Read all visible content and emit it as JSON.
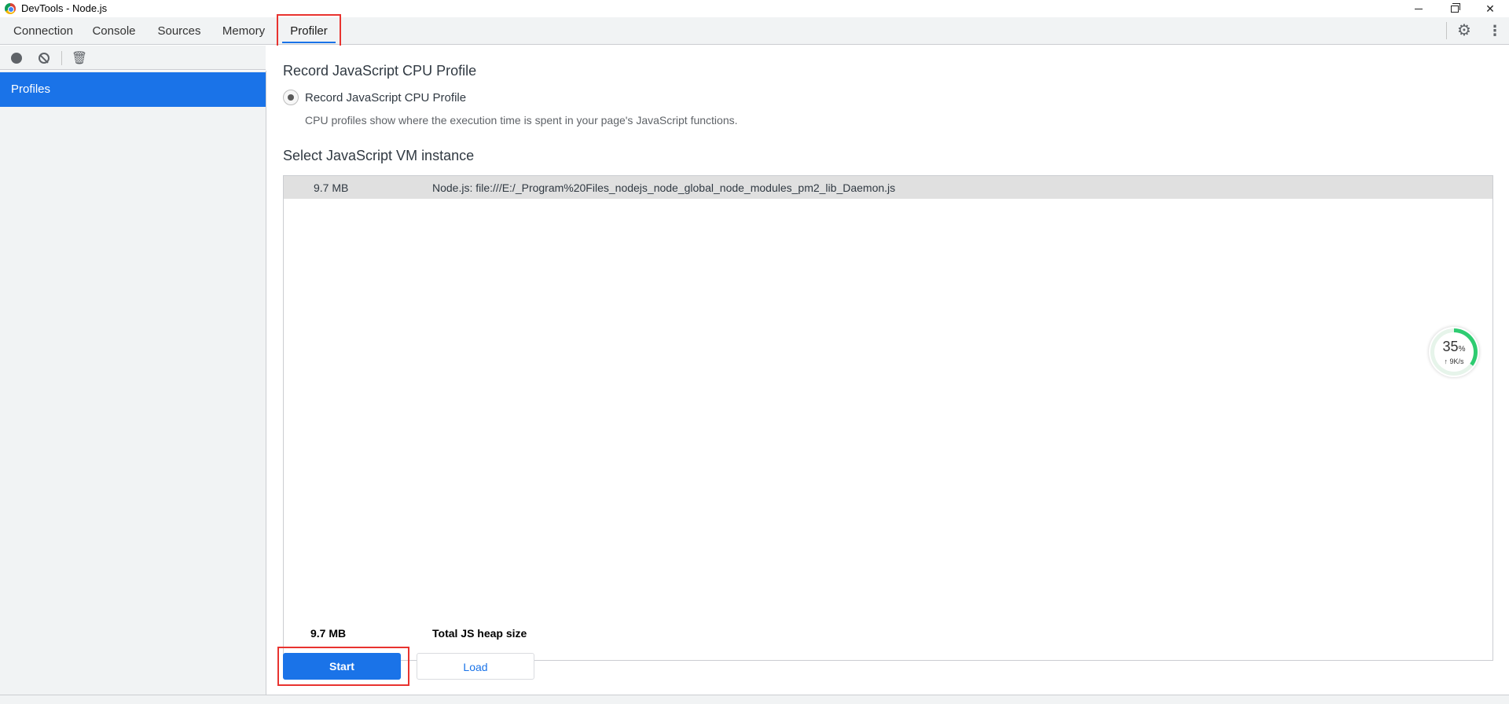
{
  "window": {
    "title": "DevTools - Node.js",
    "minimize": "",
    "maximize": "",
    "close": "✕"
  },
  "tabs": [
    {
      "label": "Connection"
    },
    {
      "label": "Console"
    },
    {
      "label": "Sources"
    },
    {
      "label": "Memory"
    },
    {
      "label": "Profiler",
      "active": true
    }
  ],
  "toolbar": {
    "settings_icon": "gear-icon",
    "more_icon": "kebab-menu-icon",
    "record_icon": "record-icon",
    "clear_icon": "clear-icon",
    "delete_icon": "trash-icon"
  },
  "sidebar": {
    "items": [
      {
        "label": "Profiles",
        "selected": true
      }
    ]
  },
  "main": {
    "heading": "Record JavaScript CPU Profile",
    "radio_label": "Record JavaScript CPU Profile",
    "radio_description": "CPU profiles show where the execution time is spent in your page's JavaScript functions.",
    "vm_heading": "Select JavaScript VM instance",
    "vm_instances": [
      {
        "size": "9.7 MB",
        "name": "Node.js: file:///E:/_Program%20Files_nodejs_node_global_node_modules_pm2_lib_Daemon.js"
      }
    ],
    "total_size": "9.7 MB",
    "total_label": "Total JS heap size",
    "start_label": "Start",
    "load_label": "Load"
  },
  "speed_widget": {
    "percent": "35",
    "percent_unit": "%",
    "rate": "↑ 9K/s",
    "fill_fraction": 0.35
  },
  "colors": {
    "accent": "#1a73e8",
    "highlight": "#e8332f",
    "widget_green": "#2ecc71"
  }
}
